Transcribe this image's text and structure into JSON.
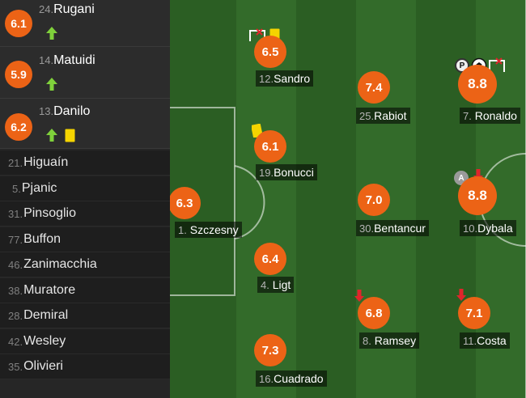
{
  "substitutes": [
    {
      "rating": "6.1",
      "number": "24.",
      "name": "Rugani"
    },
    {
      "rating": "5.9",
      "number": "14.",
      "name": "Matuidi"
    },
    {
      "rating": "6.2",
      "number": "13.",
      "name": "Danilo"
    }
  ],
  "bench": [
    {
      "number": "21.",
      "name": "Higuaín"
    },
    {
      "number": "5.",
      "name": "Pjanic"
    },
    {
      "number": "31.",
      "name": "Pinsoglio"
    },
    {
      "number": "77.",
      "name": "Buffon"
    },
    {
      "number": "46.",
      "name": "Zanimacchia"
    },
    {
      "number": "38.",
      "name": "Muratore"
    },
    {
      "number": "28.",
      "name": "Demiral"
    },
    {
      "number": "42.",
      "name": "Wesley"
    },
    {
      "number": "35.",
      "name": "Olivieri"
    }
  ],
  "lineup": [
    {
      "rating": "6.3",
      "number": "1.",
      "name": "Szczesny"
    },
    {
      "rating": "6.5",
      "number": "12.",
      "name": "Sandro"
    },
    {
      "rating": "6.1",
      "number": "19.",
      "name": "Bonucci"
    },
    {
      "rating": "6.4",
      "number": "4.",
      "name": "Ligt"
    },
    {
      "rating": "7.3",
      "number": "16.",
      "name": "Cuadrado"
    },
    {
      "rating": "7.4",
      "number": "25.",
      "name": "Rabiot"
    },
    {
      "rating": "7.0",
      "number": "30.",
      "name": "Bentancur"
    },
    {
      "rating": "6.8",
      "number": "8.",
      "name": "Ramsey"
    },
    {
      "rating": "8.8",
      "number": "7.",
      "name": "Ronaldo"
    },
    {
      "rating": "8.8",
      "number": "10.",
      "name": "Dybala"
    },
    {
      "rating": "7.1",
      "number": "11.",
      "name": "Costa"
    }
  ],
  "badges": {
    "assist": "A",
    "penalty": "P"
  },
  "colors": {
    "rating": "#ec6316",
    "pitch_dark": "#2b5e23",
    "pitch_light": "#336b2a",
    "sub_in_arrow": "#7fd13b",
    "sub_out_arrow": "#e0252b",
    "yellow_card": "#f5d400"
  },
  "icons": [
    "sub-in-arrow-icon",
    "sub-out-arrow-icon",
    "yellow-card-icon",
    "missed-chance-icon",
    "penalty-goal-icon",
    "goal-ball-icon",
    "assist-icon"
  ]
}
